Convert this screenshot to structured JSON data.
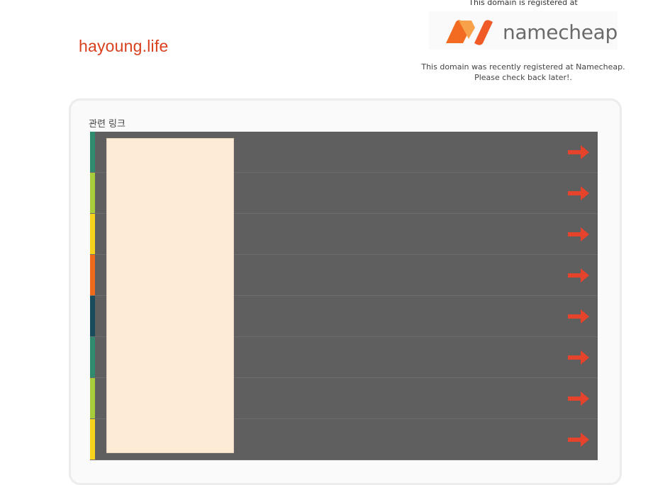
{
  "site": {
    "domain": "hayoung.life"
  },
  "registrar": {
    "registered_at_text": "This domain is registered at",
    "logo_word": "namecheap",
    "logo_icon": "namecheap-n-logo",
    "note": "This domain was recently registered at Namecheap. Please check back later!."
  },
  "related": {
    "title": "관련 링크",
    "links": [
      {
        "stripe": "#2f8a6e",
        "icon": "arrow-right-icon"
      },
      {
        "stripe": "#a8cd3a",
        "icon": "arrow-right-icon"
      },
      {
        "stripe": "#f6d31a",
        "icon": "arrow-right-icon"
      },
      {
        "stripe": "#ef6a1a",
        "icon": "arrow-right-icon"
      },
      {
        "stripe": "#184b5c",
        "icon": "arrow-right-icon"
      },
      {
        "stripe": "#2f8a6e",
        "icon": "arrow-right-icon"
      },
      {
        "stripe": "#a8cd3a",
        "icon": "arrow-right-icon"
      },
      {
        "stripe": "#f6d31a",
        "icon": "arrow-right-icon"
      }
    ]
  },
  "colors": {
    "brand_text": "#d9411e",
    "arrow": "#e5432b",
    "row_bg": "#5f5f5f",
    "overlay": "#feebd5"
  }
}
